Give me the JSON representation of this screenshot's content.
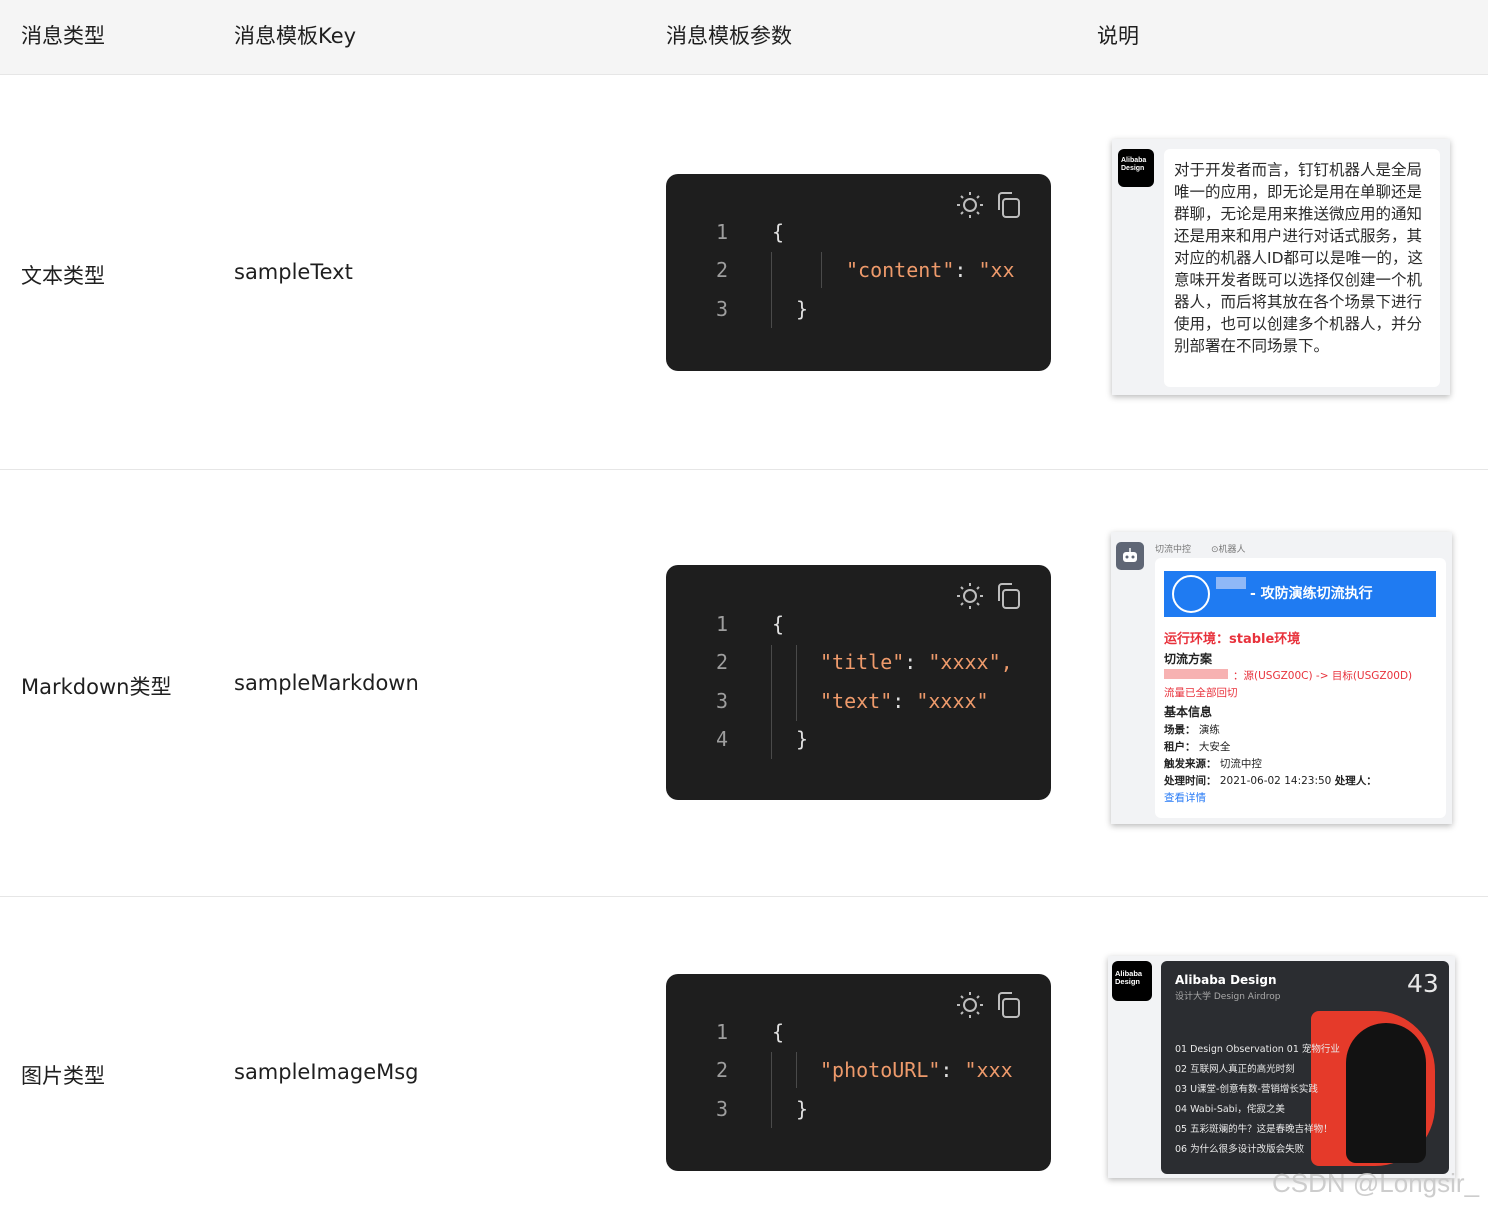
{
  "header": {
    "col_type": "消息类型",
    "col_key": "消息模板Key",
    "col_params": "消息模板参数",
    "col_desc": "说明"
  },
  "rows": [
    {
      "type": "文本类型",
      "key": "sampleText",
      "code": {
        "line_numbers": [
          "1",
          "2",
          "3"
        ],
        "open": "{",
        "close": "}",
        "field": "\"content\"",
        "value": "\"xx"
      }
    },
    {
      "type": "Markdown类型",
      "key": "sampleMarkdown",
      "code": {
        "line_numbers": [
          "1",
          "2",
          "3",
          "4"
        ],
        "open": "{",
        "close": "}",
        "field1": "\"title\"",
        "value1": "\"xxxx\"",
        "field2": "\"text\"",
        "value2": "\"xxxx\""
      }
    },
    {
      "type": "图片类型",
      "key": "sampleImageMsg",
      "code": {
        "line_numbers": [
          "1",
          "2",
          "3"
        ],
        "open": "{",
        "close": "}",
        "field": "\"photoURL\"",
        "value": "\"xxx"
      }
    }
  ],
  "icons": {
    "theme": "sun-icon",
    "copy": "copy-icon"
  },
  "preview_text": {
    "logo": "Alibaba Design",
    "body": "对于开发者而言，钉钉机器人是全局唯一的应用，即无论是用在单聊还是群聊，无论是用来推送微应用的通知还是用来和用户进行对话式服务，其对应的机器人ID都可以是唯一的，这意味开发者既可以选择仅创建一个机器人，而后将其放在各个场景下进行使用，也可以创建多个机器人，并分别部署在不同场景下。"
  },
  "preview_markdown": {
    "sender": "切流中控",
    "sender_tag": "机器人",
    "banner_title": "- 攻防演练切流执行",
    "env": "运行环境：stable环境",
    "plan_title": "切流方案",
    "plan_detail": "：源(USGZ00C) -> 目标(USGZ00D)",
    "plan_status": "流量已全部回切",
    "info_title": "基本信息",
    "scene_label": "场景：",
    "scene_value": "演练",
    "tenant_label": "租户：",
    "tenant_value": "大安全",
    "source_label": "触发来源：",
    "source_value": "切流中控",
    "time_label": "处理时间：",
    "time_value": "2021-06-02 14:23:50",
    "handler_label": "处理人：",
    "detail_link": "查看详情"
  },
  "preview_image": {
    "logo": "Alibaba Design",
    "brand": "Alibaba Design",
    "subtitle": "设计大学 Design Airdrop",
    "number": "43",
    "items": [
      "01 Design Observation 01 宠物行业",
      "02 互联网人真正的高光时刻",
      "03 U课堂-创意有数-营销增长实践",
      "04 Wabi-Sabi，侘寂之美",
      "05 五彩斑斓的牛？这是春晚吉祥物！",
      "06 为什么很多设计改版会失败"
    ]
  },
  "watermark": "CSDN @Longsir_"
}
